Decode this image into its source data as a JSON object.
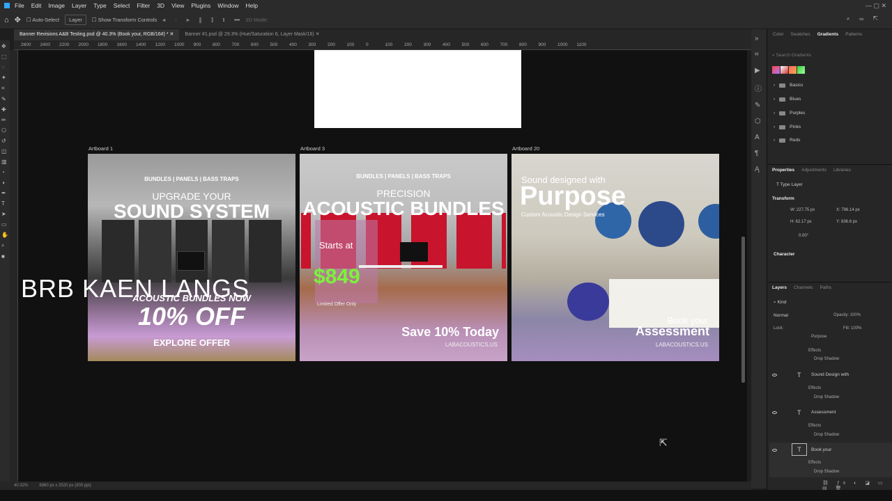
{
  "menu": [
    "File",
    "Edit",
    "Image",
    "Layer",
    "Type",
    "Select",
    "Filter",
    "3D",
    "View",
    "Plugins",
    "Window",
    "Help"
  ],
  "options": {
    "auto_select": "Auto-Select",
    "layer_select": "Layer",
    "transform": "Show Transform Controls",
    "mode3d": "3D Mode:"
  },
  "tabs": [
    {
      "label": "Banner Revisions A&B Testing.psd @ 40.3% (Book your, RGB/16#) *",
      "active": true
    },
    {
      "label": "Banner #1.psd @ 29.3% (Hue/Saturation 6, Layer Mask/16)",
      "active": false
    }
  ],
  "ruler": [
    "2600",
    "2400",
    "2200",
    "2000",
    "1800",
    "1600",
    "1400",
    "1200",
    "1000",
    "900",
    "800",
    "700",
    "600",
    "500",
    "400",
    "300",
    "200",
    "100",
    "0",
    "100",
    "200",
    "300",
    "400",
    "500",
    "600",
    "700",
    "800",
    "900",
    "1000",
    "1100"
  ],
  "artboards": [
    {
      "label": "Artboard 1",
      "tagline": "BUNDLES | PANELS | BASS TRAPS",
      "line1": "UPGRADE YOUR",
      "line2": "SOUND SYSTEM",
      "promo": "ACOUSTIC BUNDLES NOW",
      "discount": "10% OFF",
      "cta": "EXPLORE OFFER"
    },
    {
      "label": "Artboard 3",
      "tagline": "BUNDLES | PANELS | BASS TRAPS",
      "line1": "PRECISION",
      "line2": "ACOUSTIC BUNDLES",
      "starts": "Starts at",
      "price": "$849",
      "limited": "Limited Offer Only",
      "save": "Save 10% Today",
      "site": "LABACOUSTICS.US"
    },
    {
      "label": "Artboard 20",
      "line1": "Sound designed with",
      "line2": "Purpose",
      "sub": "Custom Acoustic Design Services",
      "book": "Book your",
      "assess": "Assessment",
      "site": "LABACOUSTICS.US"
    }
  ],
  "overlay_text": "BRB KAEN LANGS",
  "status": {
    "zoom": "40.32%",
    "size": "6960 px x 2520 px (300 ppi)"
  },
  "panels": {
    "top_tabs": [
      "Color",
      "Swatches",
      "Gradients",
      "Patterns"
    ],
    "search_placeholder": "Search Gradients",
    "gradient_groups": [
      "Basics",
      "Blues",
      "Purples",
      "Pinks",
      "Reds"
    ],
    "props_tabs": [
      "Properties",
      "Adjustments",
      "Libraries"
    ],
    "type_layer": "Type Layer",
    "transform": "Transform",
    "w": "W: 227.75 px",
    "x": "X: 796.14 px",
    "h": "H: 62.17 px",
    "y": "Y: 836.6 px",
    "angle": "0.00°",
    "character": "Character",
    "layers_tabs": [
      "Layers",
      "Channels",
      "Paths"
    ],
    "kind": "Kind",
    "blend": "Normal",
    "opacity_label": "Opacity:",
    "opacity": "100%",
    "lock": "Lock:",
    "fill_label": "Fill:",
    "fill": "100%",
    "layers": [
      {
        "name": "Purpose",
        "effects": "Effects",
        "shadow": "Drop Shadow"
      },
      {
        "name": "Sound Design with",
        "effects": "Effects",
        "shadow": "Drop Shadow"
      },
      {
        "name": "Assessment",
        "effects": "Effects",
        "shadow": "Drop Shadow"
      },
      {
        "name": "Book your",
        "effects": "Effects",
        "shadow": "Drop Shadow"
      }
    ]
  }
}
